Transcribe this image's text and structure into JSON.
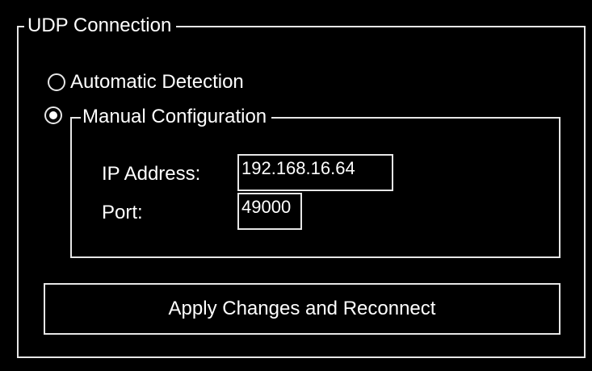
{
  "udp_connection": {
    "title": "UDP Connection",
    "options": {
      "automatic": {
        "label": "Automatic Detection",
        "selected": false
      },
      "manual": {
        "label": "Manual Configuration",
        "selected": true
      }
    },
    "manual_config": {
      "ip_address_label": "IP Address:",
      "ip_address_value": "192.168.16.64",
      "port_label": "Port:",
      "port_value": "49000"
    },
    "apply_button_label": "Apply Changes and Reconnect"
  },
  "colors": {
    "background": "#000000",
    "border": "#e6e6e6",
    "text": "#ffffff"
  }
}
